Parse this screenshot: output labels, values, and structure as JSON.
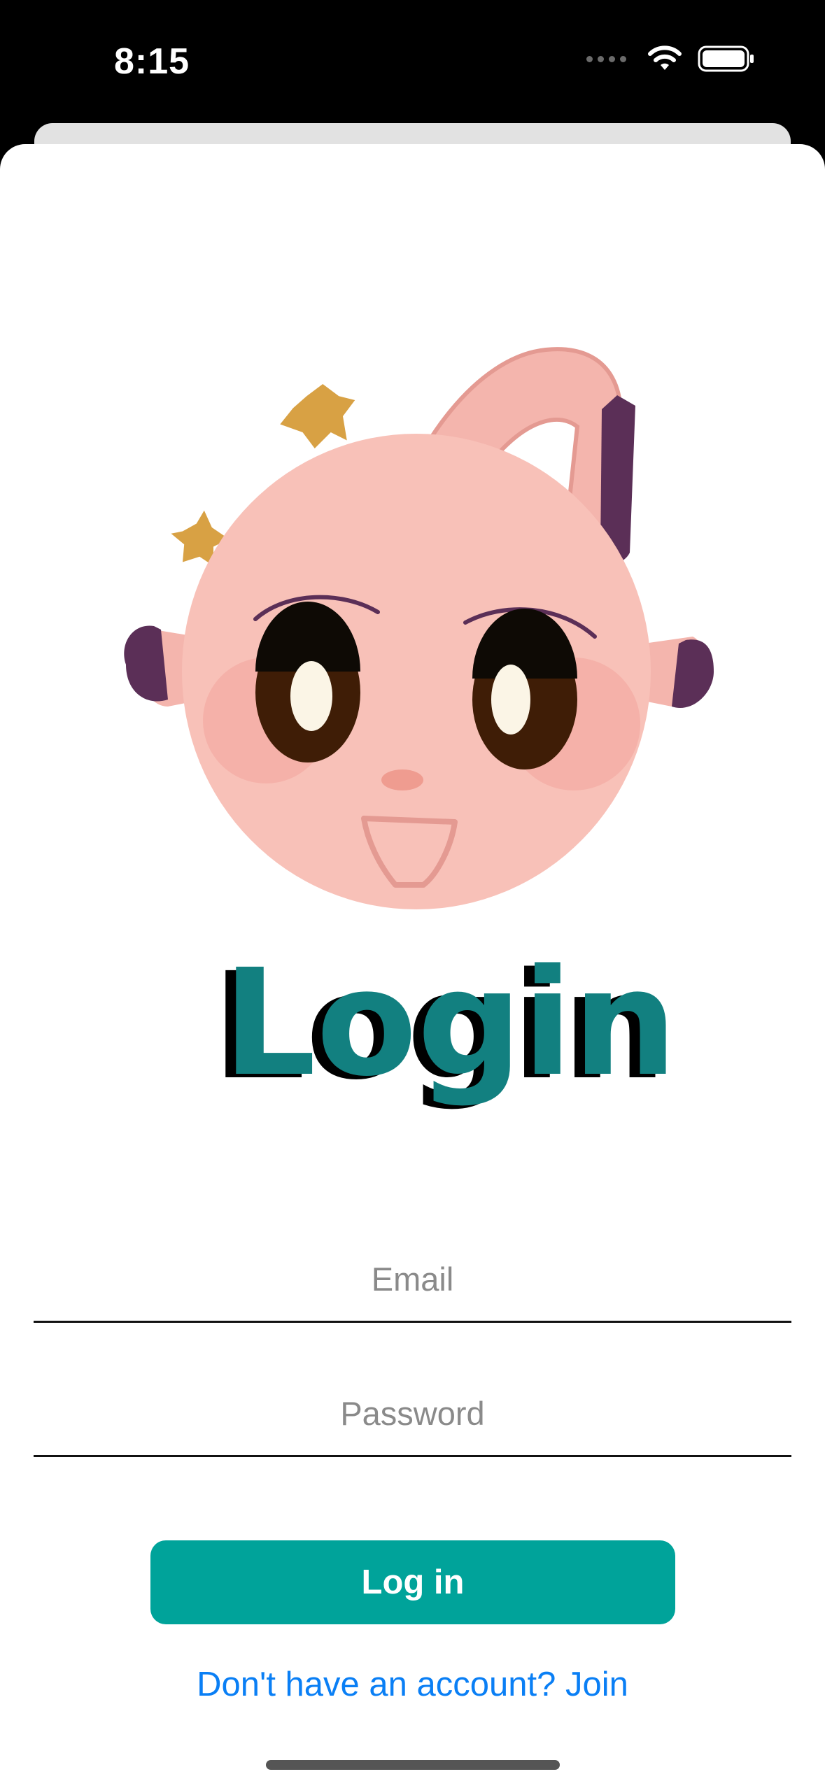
{
  "status_bar": {
    "time": "8:15"
  },
  "logo": {
    "text": "Login",
    "colors": {
      "teal": "#128080",
      "shadow": "#000000"
    }
  },
  "form": {
    "email_placeholder": "Email",
    "password_placeholder": "Password",
    "login_label": "Log in",
    "join_text": "Don't have an account? Join"
  },
  "colors": {
    "accent": "#00a39a",
    "link": "#0a7ff5",
    "mascot_skin": "#f8c1b8",
    "mascot_dark": "#5a2d55",
    "star": "#d9a143"
  }
}
